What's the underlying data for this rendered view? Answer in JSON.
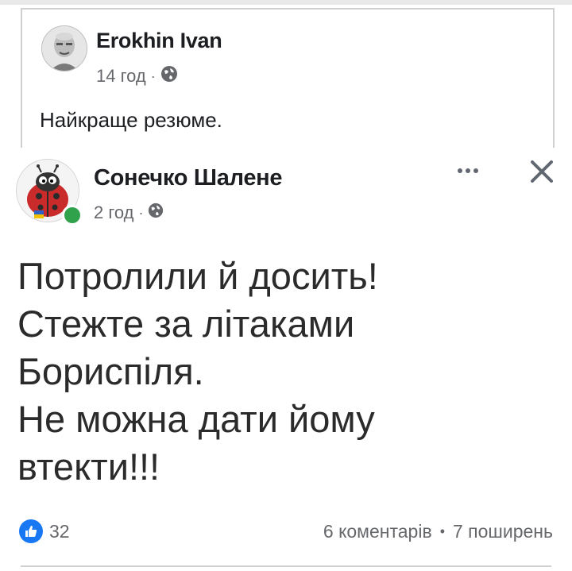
{
  "shared_post": {
    "author": "Erokhin Ivan",
    "time": "14 год",
    "separator": "·",
    "text": "Найкраще резюме."
  },
  "original_post": {
    "author": "Сонечко Шалене",
    "time": "2 год",
    "separator": "·",
    "text_lines": [
      "Потролили й досить!",
      "Стежте за літаками",
      "Бориспіля.",
      "Не можна дати йому",
      "втекти!!!"
    ],
    "reactions_count": "32",
    "comments": "6 коментарів",
    "stats_separator": "•",
    "shares": "7 поширень"
  },
  "icons": {
    "privacy": "globe-icon",
    "more": "more-options-icon",
    "close": "close-icon",
    "like": "like-icon"
  },
  "colors": {
    "like_blue": "#1877f2",
    "online_green": "#31a24c",
    "meta_gray": "#65676b"
  }
}
